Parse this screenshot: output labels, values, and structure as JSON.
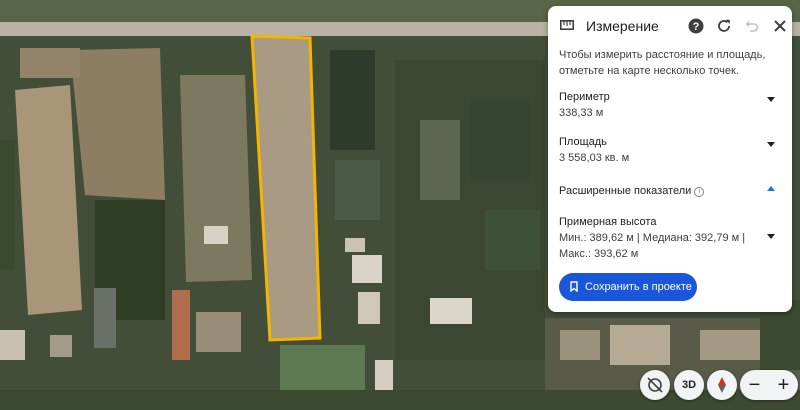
{
  "panel": {
    "title": "Измерение",
    "description": "Чтобы измерить расстояние и площадь, отметьте на карте несколько точек.",
    "perimeter": {
      "label": "Периметр",
      "value": "338,33 м"
    },
    "area": {
      "label": "Площадь",
      "value": "3 558,03 кв. м"
    },
    "advanced": {
      "label": "Расширенные показатели"
    },
    "elevation": {
      "label": "Примерная высота",
      "line1": "Мин.: 389,62 м | Медиана: 392,79 м |",
      "line2": "Макс.: 393,62 м"
    },
    "save_label": "Сохранить в проекте"
  },
  "controls": {
    "three_d_label": "3D",
    "zoom_out": "−",
    "zoom_in": "+"
  },
  "icons": [
    "ruler-icon",
    "help-icon",
    "refresh-icon",
    "undo-icon",
    "close-icon",
    "info-icon",
    "bookmark-icon",
    "rotate-icon",
    "compass-icon"
  ],
  "colors": {
    "accent": "#1a56d9",
    "measure_outline": "#f4b400"
  }
}
